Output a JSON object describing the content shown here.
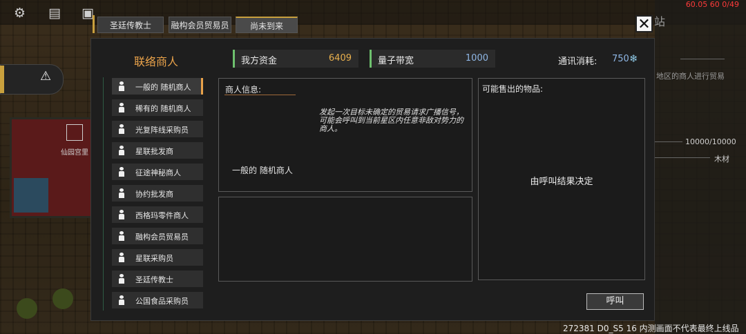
{
  "hud": {
    "fps": "60.05 60 0/49",
    "version": "272381 D0_S5 16  内测画面不代表最终上线品质",
    "right_stat": "10000/10000",
    "right_item": "木材",
    "right_hint": "地区的商人进行贸易",
    "right_title": "站",
    "map_label": "仙园宫里"
  },
  "tabs": [
    {
      "label": "圣廷传教士"
    },
    {
      "label": "融构会员贸易员"
    },
    {
      "label": "尚未到来"
    }
  ],
  "panel": {
    "title": "联络商人",
    "funds_label": "我方资金",
    "funds_value": "6409",
    "bandwidth_label": "量子带宽",
    "bandwidth_value": "1000",
    "cost_label": "通讯消耗:",
    "cost_value": "750",
    "cost_icon": "snowflake-icon"
  },
  "merchants": [
    {
      "label": "一般的 随机商人"
    },
    {
      "label": "稀有的 随机商人"
    },
    {
      "label": "光复阵线采购员"
    },
    {
      "label": "星联批发商"
    },
    {
      "label": "征途神秘商人"
    },
    {
      "label": "协约批发商"
    },
    {
      "label": "西格玛零件商人"
    },
    {
      "label": "融构会员贸易员"
    },
    {
      "label": "星联采购员"
    },
    {
      "label": "圣廷传教士"
    },
    {
      "label": "公国食品采购员"
    }
  ],
  "info": {
    "title": "商人信息:",
    "description": "发起一次目标未确定的贸易请求广播信号，可能会呼叫到当前星区内任意非敌对势力的商人。",
    "merchant_name": "一般的 随机商人"
  },
  "goods": {
    "title": "可能售出的物品:",
    "result": "由呼叫结果决定"
  },
  "call_button": "呼叫",
  "colors": {
    "accent_gold": "#c9a03d",
    "title_orange": "#e9a24a",
    "value_blue": "#8fb7e6",
    "green_bar": "#6ec16e"
  }
}
